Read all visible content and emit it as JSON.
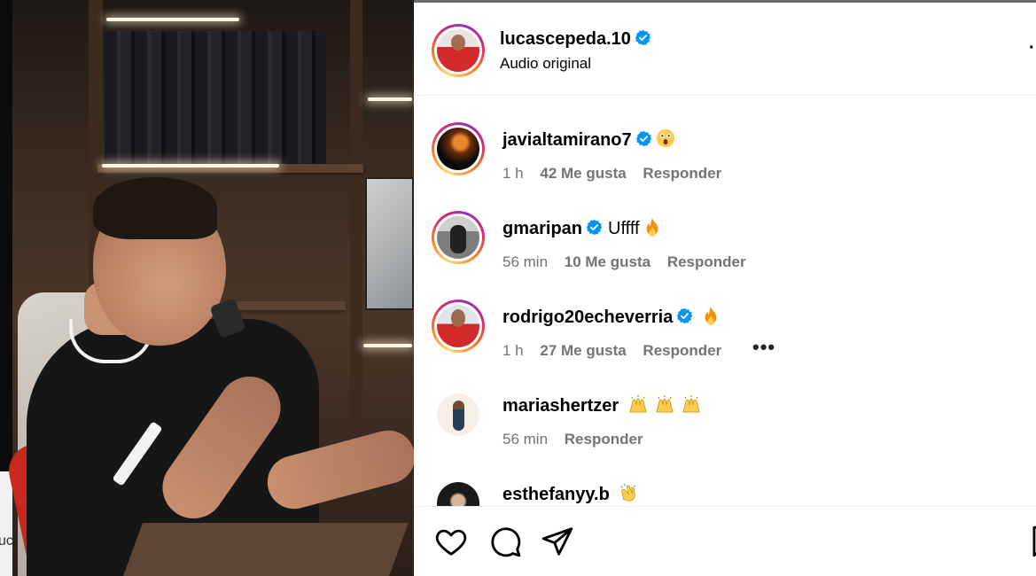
{
  "post": {
    "author": {
      "username": "lucascepeda.10",
      "verified": true
    },
    "audio_label": "Audio original",
    "more_options_icon": "more-horizontal-icon"
  },
  "comments": [
    {
      "username": "javialtamirano7",
      "verified": true,
      "text": "",
      "emojis": [
        "astonished-face"
      ],
      "time": "1 h",
      "likes": "42 Me gusta",
      "reply": "Responder",
      "story_ring": true
    },
    {
      "username": "gmaripan",
      "verified": true,
      "text": "Uffff",
      "emojis": [
        "fire"
      ],
      "time": "56 min",
      "likes": "10 Me gusta",
      "reply": "Responder",
      "story_ring": true
    },
    {
      "username": "rodrigo20echeverria",
      "verified": true,
      "text": "",
      "emojis": [
        "fire"
      ],
      "time": "1 h",
      "likes": "27 Me gusta",
      "reply": "Responder",
      "story_ring": true,
      "more": "•••"
    },
    {
      "username": "mariashertzer",
      "verified": false,
      "text": "",
      "emojis": [
        "raising-hands",
        "raising-hands",
        "raising-hands"
      ],
      "time": "56 min",
      "likes": "",
      "reply": "Responder",
      "story_ring": false
    },
    {
      "username": "esthefanyy.b",
      "verified": false,
      "text": "",
      "emojis": [
        "clapping-hands"
      ],
      "time": "",
      "likes": "",
      "reply": "",
      "story_ring": false
    }
  ],
  "actions": [
    "like-icon",
    "comment-icon",
    "share-icon",
    "save-icon"
  ],
  "colors": {
    "verified_blue": "#0095f6",
    "meta_gray": "#737373",
    "divider": "#efefef"
  },
  "media": {
    "left_edge_fragment": "uc"
  }
}
